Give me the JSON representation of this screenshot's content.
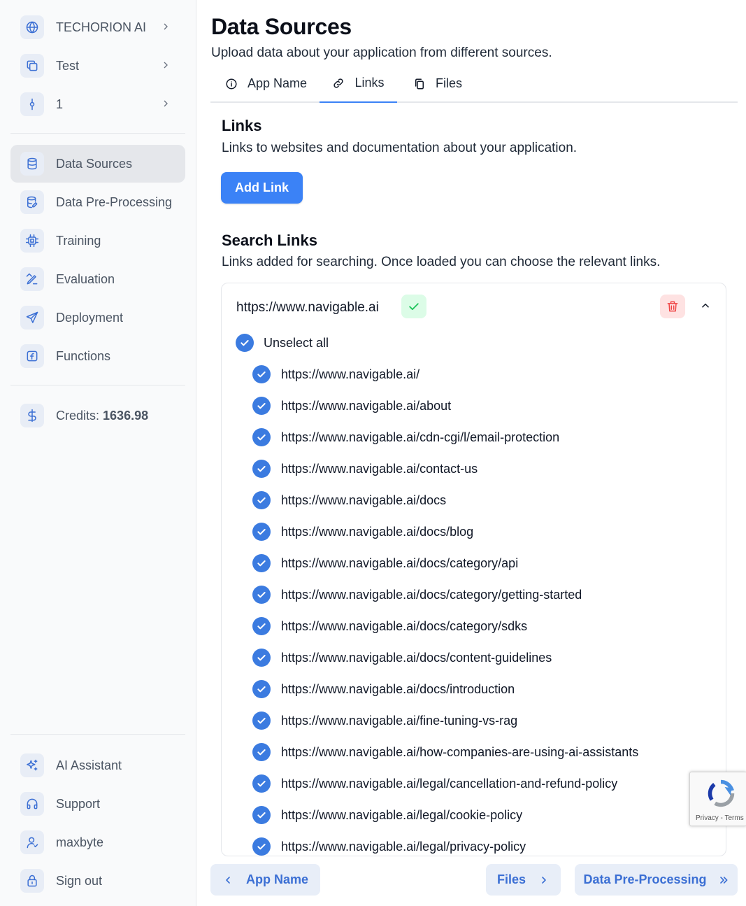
{
  "sidebar": {
    "org": "TECHORION AI",
    "project": "Test",
    "version": "1",
    "nav": [
      {
        "label": "Data Sources",
        "icon": "database-icon"
      },
      {
        "label": "Data Pre-Processing",
        "icon": "database-edit-icon"
      },
      {
        "label": "Training",
        "icon": "cpu-icon"
      },
      {
        "label": "Evaluation",
        "icon": "pen-ruler-icon"
      },
      {
        "label": "Deployment",
        "icon": "send-icon"
      },
      {
        "label": "Functions",
        "icon": "function-icon"
      }
    ],
    "credits_label": "Credits:",
    "credits_value": "1636.98",
    "bottom": [
      {
        "label": "AI Assistant",
        "icon": "sparkles-icon"
      },
      {
        "label": "Support",
        "icon": "headphones-icon"
      },
      {
        "label": "maxbyte",
        "icon": "user-icon"
      },
      {
        "label": "Sign out",
        "icon": "lock-icon"
      }
    ]
  },
  "page": {
    "title": "Data Sources",
    "subtitle": "Upload data about your application from different sources."
  },
  "tabs": [
    {
      "label": "App Name",
      "icon": "info-icon"
    },
    {
      "label": "Links",
      "icon": "link-icon",
      "active": true
    },
    {
      "label": "Files",
      "icon": "files-icon"
    }
  ],
  "links_section": {
    "title": "Links",
    "subtitle": "Links to websites and documentation about your application.",
    "add_button": "Add Link"
  },
  "search_section": {
    "title": "Search Links",
    "subtitle": "Links added for searching. Once loaded you can choose the relevant links."
  },
  "link_group": {
    "url": "https://www.navigable.ai",
    "unselect_all": "Unselect all",
    "links": [
      "https://www.navigable.ai/",
      "https://www.navigable.ai/about",
      "https://www.navigable.ai/cdn-cgi/l/email-protection",
      "https://www.navigable.ai/contact-us",
      "https://www.navigable.ai/docs",
      "https://www.navigable.ai/docs/blog",
      "https://www.navigable.ai/docs/category/api",
      "https://www.navigable.ai/docs/category/getting-started",
      "https://www.navigable.ai/docs/category/sdks",
      "https://www.navigable.ai/docs/content-guidelines",
      "https://www.navigable.ai/docs/introduction",
      "https://www.navigable.ai/fine-tuning-vs-rag",
      "https://www.navigable.ai/how-companies-are-using-ai-assistants",
      "https://www.navigable.ai/legal/cancellation-and-refund-policy",
      "https://www.navigable.ai/legal/cookie-policy",
      "https://www.navigable.ai/legal/privacy-policy"
    ]
  },
  "footer_nav": {
    "back": "App Name",
    "next": "Files",
    "skip": "Data Pre-Processing"
  },
  "recaptcha": {
    "terms": "Privacy - Terms"
  },
  "colors": {
    "primary": "#3b82f6",
    "success": "#22c55e",
    "danger": "#ef4444"
  }
}
